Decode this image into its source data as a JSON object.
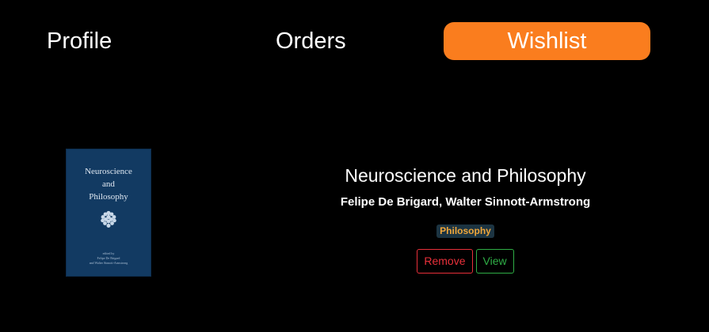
{
  "tabs": {
    "profile": "Profile",
    "orders": "Orders",
    "wishlist": "Wishlist",
    "active": "wishlist",
    "active_color": "#fa7d1e"
  },
  "wishlist": {
    "items": [
      {
        "cover": {
          "title_line1": "Neuroscience",
          "title_line2": "and",
          "title_line3": "Philosophy",
          "credit_line1": "edited by",
          "credit_line2": "Felipe De Brigard",
          "credit_line3": "and Walter Sinnott-Armstrong",
          "background": "#123a62"
        },
        "title": "Neuroscience and Philosophy",
        "authors": "Felipe De Brigard, Walter Sinnott-Armstrong",
        "category": "Philosophy",
        "category_color": "#f0a63a",
        "category_background": "#1c3442",
        "remove_label": "Remove",
        "remove_color": "#e8303a",
        "view_label": "View",
        "view_color": "#2fae46"
      }
    ]
  }
}
